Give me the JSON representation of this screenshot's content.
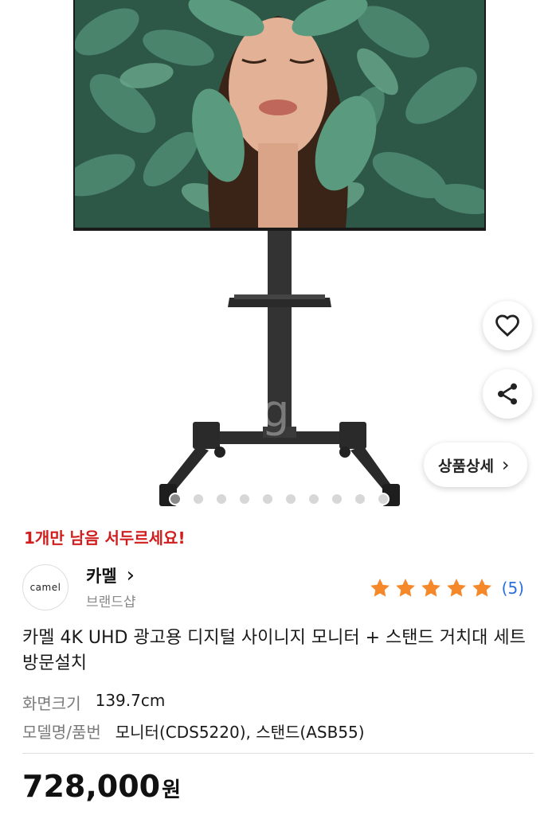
{
  "product_image": {
    "watermark_letter": "g",
    "carousel_dots": 10,
    "active_dot": 0
  },
  "floating": {
    "like_icon": "heart-icon",
    "share_icon": "share-icon",
    "detail_label": "상품상세",
    "detail_chevron": "›"
  },
  "stock_notice": "1개만 남음 서두르세요!",
  "brand": {
    "logo_text": "camel",
    "name": "카멜",
    "chevron": "›",
    "subtitle": "브랜드샵"
  },
  "rating": {
    "stars": 5,
    "max_stars": 5,
    "count": "(5)",
    "star_color": "#f5892a"
  },
  "product_title": "카멜 4K UHD 광고용 디지털 사이니지 모니터 + 스탠드 거치대 세트 방문설치",
  "specs": [
    {
      "label": "화면크기",
      "value": "139.7cm"
    },
    {
      "label": "모델명/품번",
      "value": "모니터(CDS5220), 스탠드(ASB55)"
    }
  ],
  "price": {
    "amount": "728,000",
    "unit": "원"
  },
  "colors": {
    "urgent": "#d01e1e",
    "link_blue": "#2a6fdb"
  }
}
